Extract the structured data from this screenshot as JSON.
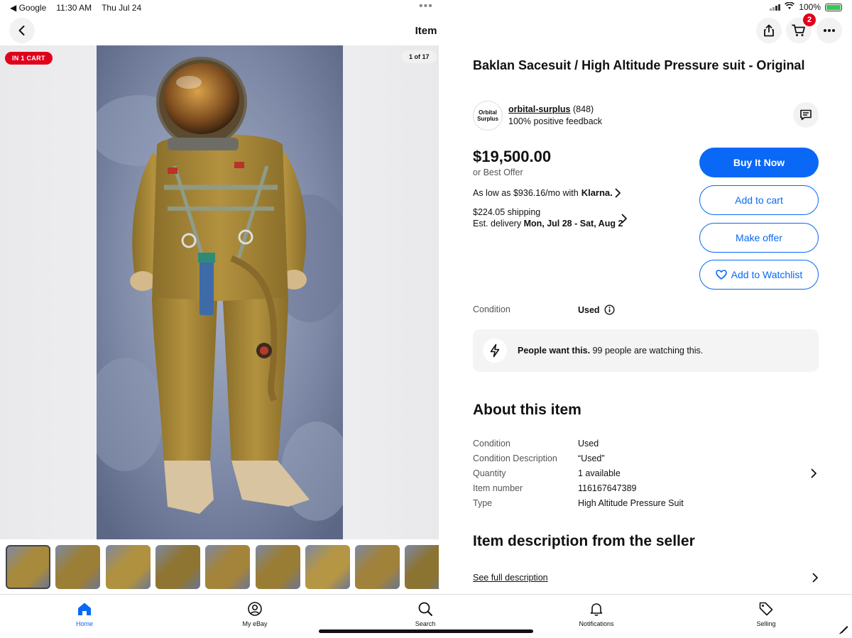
{
  "status_bar": {
    "back_app": "◀ Google",
    "time": "11:30 AM",
    "date": "Thu Jul 24",
    "battery": "100%"
  },
  "nav": {
    "title": "Item",
    "cart_count": "2"
  },
  "media": {
    "cart_pill": "IN 1 CART",
    "counter": "1 of 17",
    "thumbnail_count": 9,
    "selected_thumbnail": 1
  },
  "listing": {
    "title": "Baklan  Sacesuit / High Altitude Pressure suit - Original",
    "seller": {
      "logo_line1": "Orbital",
      "logo_line2": "Surplus",
      "name": "orbital-surplus",
      "count": "(848)",
      "feedback": "100% positive feedback"
    },
    "price": "$19,500.00",
    "best_offer": "or Best Offer",
    "klarna_prefix": "As low as $936.16/mo with",
    "klarna_brand": "Klarna.",
    "shipping": "$224.05 shipping",
    "delivery_prefix": "Est. delivery ",
    "delivery_dates": "Mon, Jul 28 - Sat, Aug 2",
    "buttons": {
      "buy_now": "Buy It Now",
      "add_to_cart": "Add to cart",
      "make_offer": "Make offer",
      "watchlist": "Add to Watchlist"
    },
    "condition_label": "Condition",
    "condition_value": "Used",
    "watch_bold": "People want this.",
    "watch_text": " 99 people are watching this."
  },
  "about": {
    "heading": "About this item",
    "specs": [
      {
        "k": "Condition",
        "v": "Used"
      },
      {
        "k": "Condition Description",
        "v": "“Used”"
      },
      {
        "k": "Quantity",
        "v": "1 available"
      },
      {
        "k": "Item number",
        "v": "116167647389"
      },
      {
        "k": "Type",
        "v": "High Altitude Pressure Suit"
      }
    ]
  },
  "description": {
    "heading": "Item description from the seller",
    "link": "See full description"
  },
  "tabs": {
    "home": "Home",
    "my_ebay": "My eBay",
    "search": "Search",
    "notifications": "Notifications",
    "selling": "Selling"
  },
  "colors": {
    "accent": "#0968f6",
    "badge_red": "#e0001b",
    "suit_olive": "#a88a3c"
  }
}
